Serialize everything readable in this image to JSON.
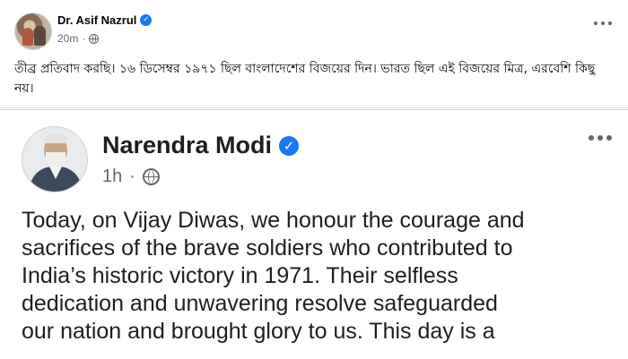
{
  "outer_post": {
    "author": "Dr. Asif Nazrul",
    "time": "20m",
    "body": "তীব্র প্রতিবাদ করছি। ১৬ ডিসেম্বর ১৯৭১ ছিল বাংলাদেশের বিজয়ের দিন। ভারত ছিল এই বিজয়ের মিত্র, এরবেশি কিছু নয়।",
    "verified_icon": "verified-badge-icon",
    "privacy_icon": "globe-icon"
  },
  "shared_post": {
    "author": "Narendra Modi",
    "time": "1h",
    "verified_icon": "verified-badge-icon",
    "privacy_icon": "globe-icon",
    "body_lines": [
      "Today, on Vijay Diwas, we honour the courage and",
      "sacrifices of the brave soldiers who contributed to",
      "India’s historic victory in 1971. Their selfless",
      "dedication and unwavering resolve safeguarded",
      "our nation and brought glory to us. This day is a"
    ]
  },
  "colors": {
    "verified": "#1877f2",
    "meta_text": "#65676b",
    "body_text": "#050505"
  }
}
